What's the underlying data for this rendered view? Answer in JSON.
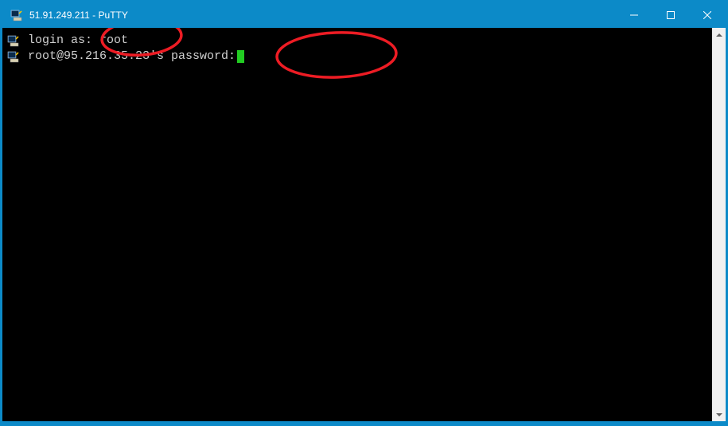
{
  "window": {
    "title": "51.91.249.211 - PuTTY"
  },
  "terminal": {
    "lines": [
      {
        "prompt": "login as: ",
        "input": "root"
      },
      {
        "prompt": "root@95.216.35.23's password:",
        "input": ""
      }
    ]
  },
  "colors": {
    "titlebar": "#0c8ac8",
    "terminal_bg": "#000000",
    "terminal_fg": "#d0d0d0",
    "cursor": "#22cc22",
    "annotation": "#ed1c24"
  }
}
